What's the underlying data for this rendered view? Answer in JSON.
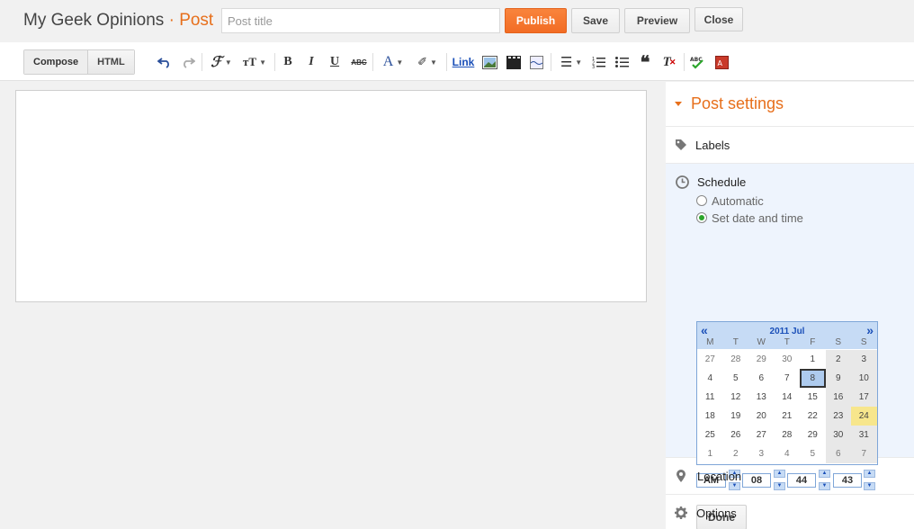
{
  "header": {
    "blog_name": "My Geek Opinions",
    "separator": "·",
    "page_type": "Post",
    "title_placeholder": "Post title",
    "publish": "Publish",
    "save": "Save",
    "preview": "Preview",
    "close": "Close"
  },
  "toolbar": {
    "compose": "Compose",
    "html": "HTML",
    "link": "Link",
    "icons": [
      "undo-icon",
      "redo-icon",
      "font-family-icon",
      "font-size-icon",
      "bold-icon",
      "italic-icon",
      "underline-icon",
      "strikethrough-icon",
      "text-color-icon",
      "highlight-icon",
      "insert-image-icon",
      "insert-video-icon",
      "insert-jump-break-icon",
      "align-icon",
      "numbered-list-icon",
      "bulleted-list-icon",
      "quote-icon",
      "remove-formatting-icon",
      "spellcheck-icon",
      "input-tools-icon"
    ],
    "accent_color": "#1a4fb8"
  },
  "sidebar": {
    "title": "Post settings",
    "labels": "Labels",
    "schedule": "Schedule",
    "automatic": "Automatic",
    "set_date": "Set date and time",
    "location": "Location",
    "options": "Options",
    "done": "Done",
    "accent_color": "#e76f1b"
  },
  "calendar": {
    "title": "2011 Jul",
    "prev": "«",
    "next": "»",
    "dow": [
      "M",
      "T",
      "W",
      "T",
      "F",
      "S",
      "S"
    ],
    "weeks": [
      [
        "27",
        "28",
        "29",
        "30",
        "1",
        "2",
        "3"
      ],
      [
        "4",
        "5",
        "6",
        "7",
        "8",
        "9",
        "10"
      ],
      [
        "11",
        "12",
        "13",
        "14",
        "15",
        "16",
        "17"
      ],
      [
        "18",
        "19",
        "20",
        "21",
        "22",
        "23",
        "24"
      ],
      [
        "25",
        "26",
        "27",
        "28",
        "29",
        "30",
        "31"
      ],
      [
        "1",
        "2",
        "3",
        "4",
        "5",
        "6",
        "7"
      ]
    ],
    "selected": "8",
    "today": "24"
  },
  "time": {
    "ampm": "AM",
    "hour": "08",
    "minute": "44",
    "second": "43"
  }
}
